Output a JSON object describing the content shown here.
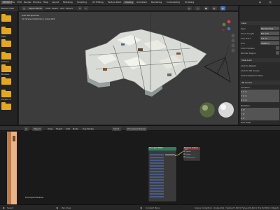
{
  "menubar": {
    "app_label": "DEMOS",
    "menus": [
      "File",
      "Edit",
      "Render",
      "Window",
      "Help"
    ],
    "tabs": [
      "Layout",
      "Modeling",
      "Sculpting",
      "UV Editing",
      "Texture Paint",
      "Shading",
      "Animation",
      "Rendering",
      "Compositing",
      "Scripting"
    ],
    "active_tab": "Shading"
  },
  "file_browser": {
    "title": "Recent Files",
    "folders": [
      "..",
      "Myis",
      "",
      "Shared",
      "Brokers",
      "",
      "Project 4"
    ]
  },
  "viewport": {
    "header": {
      "mode": "Object Mode",
      "menus": [
        "View",
        "Select",
        "Add",
        "Object"
      ]
    },
    "overlay_line1": "User Perspective",
    "overlay_line2": "(1) Scene Collection | Cube.001"
  },
  "properties": {
    "section_lens": "Lens",
    "rows": [
      {
        "label": "Type",
        "value": "Perspective"
      },
      {
        "label": "Focal Length",
        "value": "50 mm"
      },
      {
        "label": "Clip Start",
        "value": "0.1 m"
      },
      {
        "label": "End",
        "value": "1000 m"
      },
      {
        "label": "Lock Camera",
        "value": ""
      },
      {
        "label": "Render Region",
        "value": ""
      }
    ],
    "section_view_lock": "View Lock",
    "lock_rows": [
      "Lock to Object",
      "Lock to 3D Cursor",
      "Lock Camera to View"
    ],
    "section_3d_cursor": "3D Cursor",
    "location_label": "Location:",
    "location": [
      "X  0 m",
      "Y  0 m",
      "Z  0 m"
    ],
    "rotation_label": "Rotation:",
    "rotation": [
      "X  0°",
      "Y  0°",
      "Z  0°"
    ],
    "rotation_mode": "XYZ Euler"
  },
  "node_editor": {
    "header": {
      "editor": "Object",
      "menus": [
        "View",
        "Select",
        "Add",
        "Node"
      ],
      "use_nodes": "Use Nodes",
      "slot": "Slot 1",
      "material": "Principled Shader"
    },
    "bottom_label": "Principled Shader",
    "bsdf_title": "Principled BSDF",
    "output_title": "Material Output",
    "output_items": [
      "All",
      "Surface",
      "Volume",
      "Displacement"
    ]
  },
  "statusbar": {
    "left_items": [
      "Select",
      "Pan View",
      "Context Menu"
    ],
    "right_text": "Scene Collection | Cube.001 | Verts:27,318 | Faces:26,410 | Tris:52,820 | Objects:1/1 | 2.81"
  },
  "colors": {
    "accent": "#4772b3",
    "folder": "#e3a821",
    "node_teal": "#2f7d5e",
    "node_red": "#8e2d35"
  }
}
